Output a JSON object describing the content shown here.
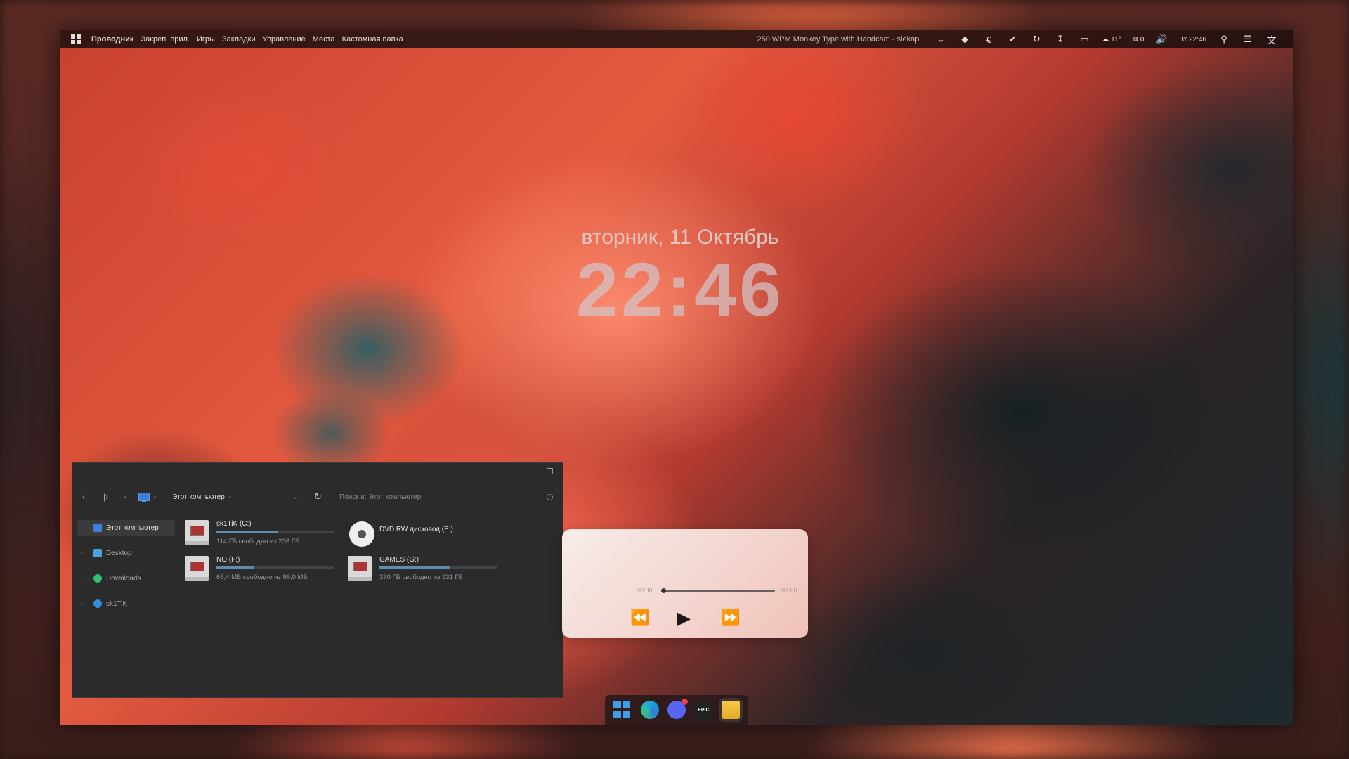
{
  "menubar": {
    "items": [
      "Проводник",
      "Закреп. прил.",
      "Игры",
      "Закладки",
      "Управление",
      "Места",
      "Кастомная папка"
    ],
    "media_title": "250 WPM Monkey Type with Handcam - slekap",
    "weather": "11°",
    "mail_count": "0",
    "clock": "Вт 22:46"
  },
  "clock": {
    "date": "вторник, 11 Октябрь",
    "time": "22:46"
  },
  "explorer": {
    "address": "Этот компьютер",
    "search_placeholder": "Поиск в: Этот компьютер",
    "sidebar": [
      {
        "label": "Этот компьютер",
        "color": "#3d7fd6"
      },
      {
        "label": "Desktop",
        "color": "#4aa3df"
      },
      {
        "label": "Downloads",
        "color": "#2fbf71"
      },
      {
        "label": "sk1TiK",
        "color": "#2f8fe0"
      }
    ],
    "drives": [
      {
        "name": "sk1TiK (C:)",
        "free": "114 ГБ свободно из 236 ГБ",
        "used_fraction": 0.52
      },
      {
        "name": "DVD RW дисковод (E:)",
        "free": "",
        "used_fraction": 0
      },
      {
        "name": "NO (F:)",
        "free": "65,4 МБ свободно из 96,0 МБ",
        "used_fraction": 0.32
      },
      {
        "name": "GAMES (G:)",
        "free": "370 ГБ свободно из 931 ГБ",
        "used_fraction": 0.6
      }
    ]
  },
  "player": {
    "time_current": "00:00",
    "time_total": "00:00",
    "progress": 0
  },
  "dock": {
    "apps": [
      "windows-start",
      "edge",
      "discord",
      "epic-games",
      "file-explorer"
    ],
    "epic_label": "EPIC"
  }
}
